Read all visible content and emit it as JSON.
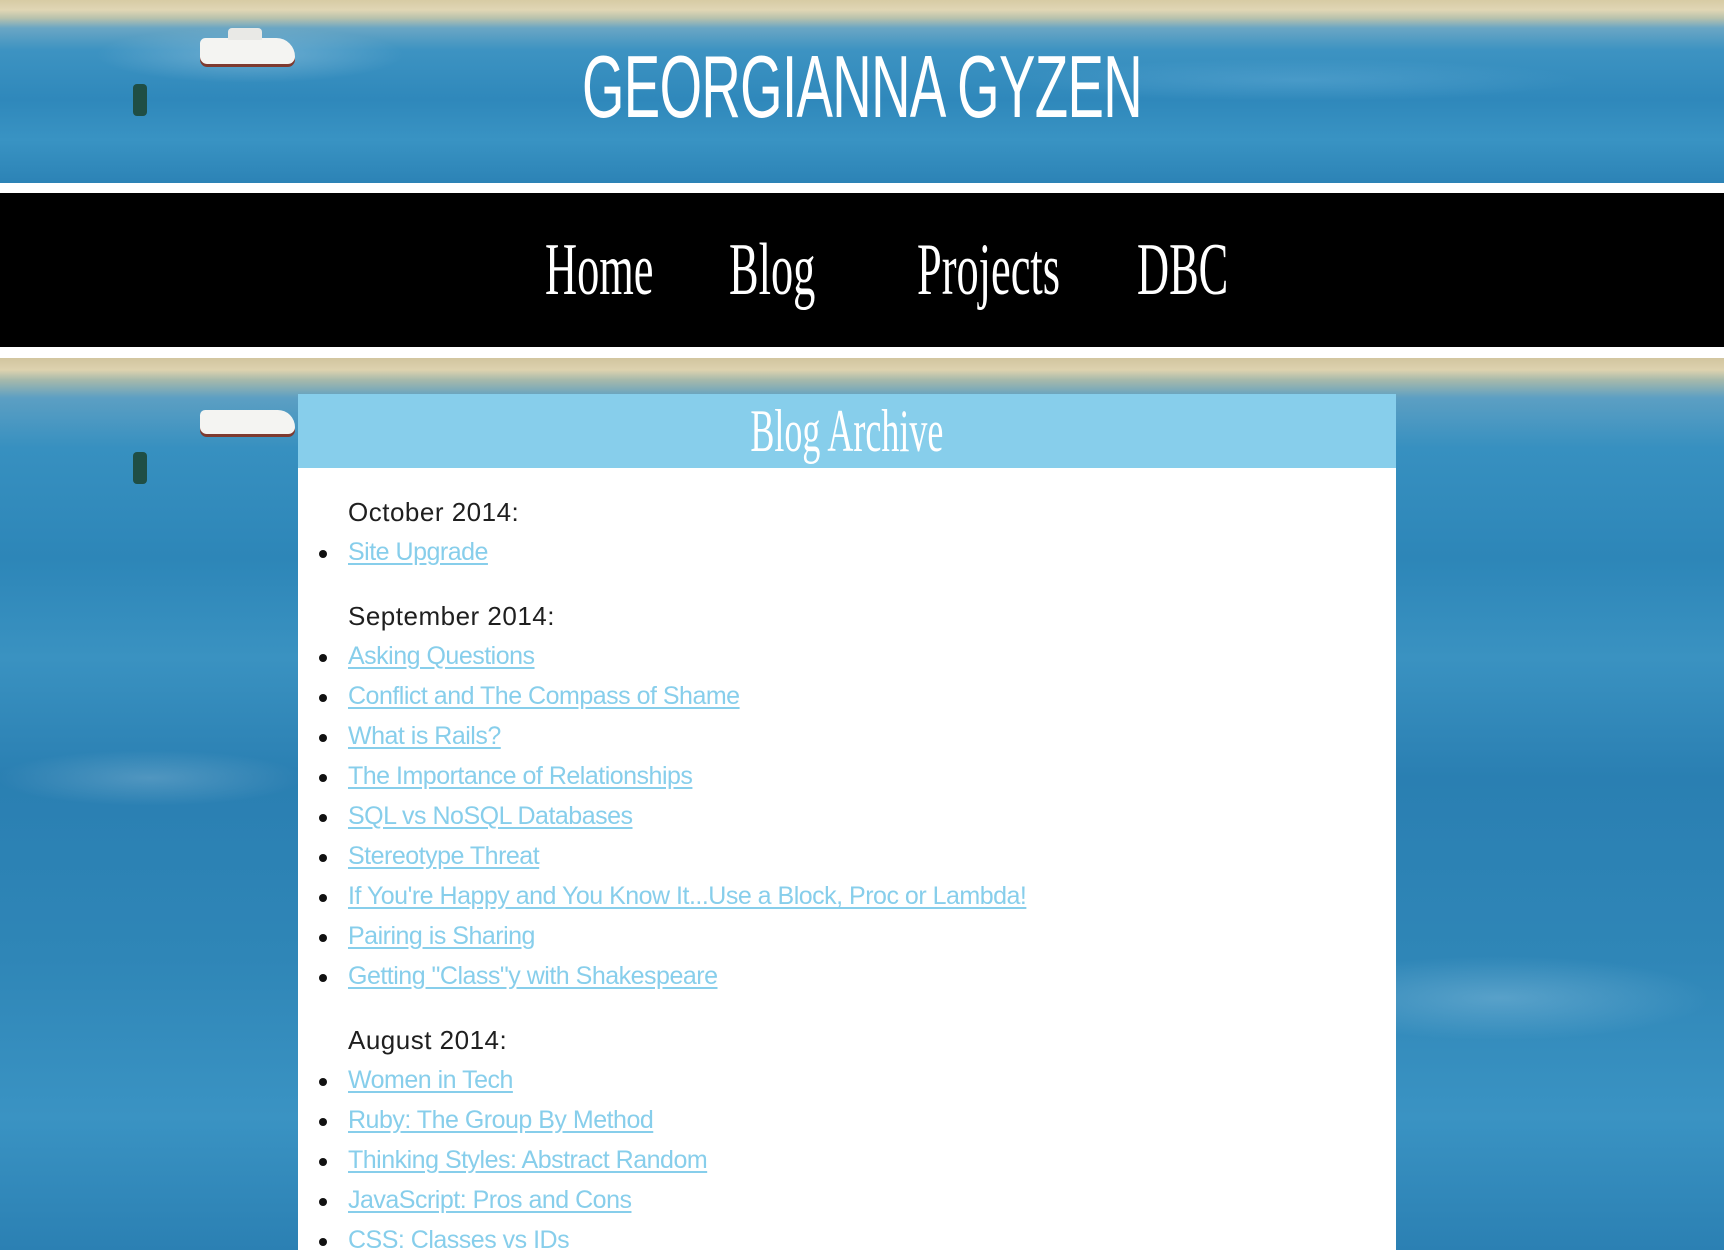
{
  "site": {
    "title": "Georgianna Gyzen"
  },
  "nav": {
    "items": [
      {
        "label": "Home"
      },
      {
        "label": "Blog"
      },
      {
        "label": "Projects"
      },
      {
        "label": "DBC"
      }
    ]
  },
  "archive": {
    "title": "Blog Archive",
    "groups": [
      {
        "month": "October 2014:",
        "posts": [
          "Site Upgrade"
        ]
      },
      {
        "month": "September 2014:",
        "posts": [
          "Asking Questions",
          "Conflict and The Compass of Shame",
          "What is Rails?",
          "The Importance of Relationships",
          "SQL vs NoSQL Databases",
          "Stereotype Threat",
          "If You're Happy and You Know It...Use a Block, Proc or Lambda!",
          "Pairing is Sharing",
          "Getting \"Class\"y with Shakespeare"
        ]
      },
      {
        "month": "August 2014:",
        "posts": [
          "Women in Tech",
          "Ruby: The Group By Method",
          "Thinking Styles: Abstract Random",
          "JavaScript: Pros and Cons",
          "CSS: Classes vs IDs"
        ]
      }
    ]
  },
  "colors": {
    "accent": "#87ceeb",
    "nav_background": "#000000",
    "card_background": "#ffffff"
  }
}
